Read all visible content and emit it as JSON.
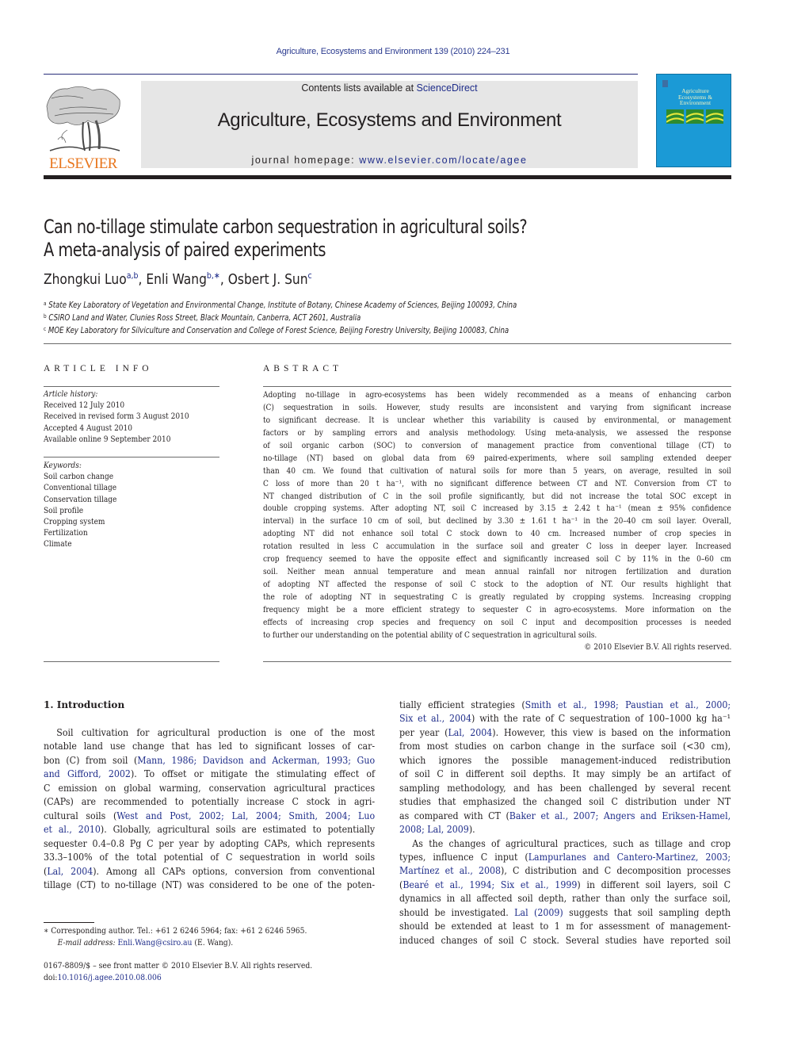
{
  "running_head": "Agriculture, Ecosystems and Environment 139 (2010) 224–231",
  "publisher": {
    "logo_text": "ELSEVIER",
    "logo_color": "#e8761d"
  },
  "banner": {
    "contents_prefix": "Contents lists available at ",
    "contents_link": "ScienceDirect",
    "journal_name": "Agriculture, Ecosystems and Environment",
    "homepage_prefix": "journal homepage: ",
    "homepage_link": "www.elsevier.com/locate/agee",
    "background": "#e6e6e6"
  },
  "cover": {
    "title_lines": [
      "Agriculture",
      "Ecosystems &",
      "Environment"
    ],
    "color": "#1b9ad6"
  },
  "article": {
    "title_line1": "Can no-tillage stimulate carbon sequestration in agricultural soils?",
    "title_line2": "A meta-analysis of paired experiments",
    "authors": [
      {
        "name": "Zhongkui Luo",
        "sup": "a,b"
      },
      {
        "name": "Enli Wang",
        "sup": "b,∗"
      },
      {
        "name": "Osbert J. Sun",
        "sup": "c"
      }
    ],
    "affiliations": [
      {
        "mark": "a",
        "text": "State Key Laboratory of Vegetation and Environmental Change, Institute of Botany, Chinese Academy of Sciences, Beijing 100093, China"
      },
      {
        "mark": "b",
        "text": "CSIRO Land and Water, Clunies Ross Street, Black Mountain, Canberra, ACT 2601, Australia"
      },
      {
        "mark": "c",
        "text": "MOE Key Laboratory for Silviculture and Conservation and College of Forest Science, Beijing Forestry University, Beijing 100083, China"
      }
    ]
  },
  "article_info": {
    "heading": "ARTICLE INFO",
    "history_label": "Article history:",
    "history": [
      "Received 12 July 2010",
      "Received in revised form 3 August 2010",
      "Accepted 4 August 2010",
      "Available online 9 September 2010"
    ],
    "keywords_label": "Keywords:",
    "keywords": [
      "Soil carbon change",
      "Conventional tillage",
      "Conservation tillage",
      "Soil profile",
      "Cropping system",
      "Fertilization",
      "Climate"
    ]
  },
  "abstract": {
    "heading": "ABSTRACT",
    "lines": [
      "Adopting no-tillage in agro-ecosystems has been widely recommended as a means of enhancing carbon",
      "(C) sequestration in soils. However, study results are inconsistent and varying from significant increase",
      "to significant decrease. It is unclear whether this variability is caused by environmental, or management",
      "factors or by sampling errors and analysis methodology. Using meta-analysis, we assessed the response",
      "of soil organic carbon (SOC) to conversion of management practice from conventional tillage (CT) to",
      "no-tillage (NT) based on global data from 69 paired-experiments, where soil sampling extended deeper",
      "than 40 cm. We found that cultivation of natural soils for more than 5 years, on average, resulted in soil",
      "C loss of more than 20 t ha⁻¹, with no significant difference between CT and NT. Conversion from CT to",
      "NT changed distribution of C in the soil profile significantly, but did not increase the total SOC except in",
      "double cropping systems. After adopting NT, soil C increased by 3.15 ± 2.42 t ha⁻¹ (mean ± 95% confidence",
      "interval) in the surface 10 cm of soil, but declined by 3.30 ± 1.61 t ha⁻¹ in the 20–40 cm soil layer. Overall,",
      "adopting NT did not enhance soil total C stock down to 40 cm. Increased number of crop species in",
      "rotation resulted in less C accumulation in the surface soil and greater C loss in deeper layer. Increased",
      "crop frequency seemed to have the opposite effect and significantly increased soil C by 11% in the 0–60 cm",
      "soil. Neither mean annual temperature and mean annual rainfall nor nitrogen fertilization and duration",
      "of adopting NT affected the response of soil C stock to the adoption of NT. Our results highlight that",
      "the role of adopting NT in sequestrating C is greatly regulated by cropping systems. Increasing cropping",
      "frequency might be a more efficient strategy to sequester C in agro-ecosystems. More information on the",
      "effects of increasing crop species and frequency on soil C input and decomposition processes is needed",
      "to further our understanding on the potential ability of C sequestration in agricultural soils."
    ],
    "copyright": "© 2010 Elsevier B.V. All rights reserved."
  },
  "introduction": {
    "heading": "1.  Introduction",
    "left_lines": [
      [
        {
          "t": "Soil cultivation for agricultural production is one of the most"
        }
      ],
      [
        {
          "t": "notable land use change that has led to significant losses of car-"
        }
      ],
      [
        {
          "t": "bon (C) from soil ("
        },
        {
          "t": "Mann, 1986; Davidson and Ackerman, 1993; Guo",
          "link": true
        }
      ],
      [
        {
          "t": "and Gifford, 2002",
          "link": true
        },
        {
          "t": "). To offset or mitigate the stimulating effect of"
        }
      ],
      [
        {
          "t": "C emission on global warming, conservation agricultural practices"
        }
      ],
      [
        {
          "t": "(CAPs) are recommended to potentially increase C stock in agri-"
        }
      ],
      [
        {
          "t": "cultural soils ("
        },
        {
          "t": "West and Post, 2002; Lal, 2004; Smith, 2004; Luo",
          "link": true
        }
      ],
      [
        {
          "t": "et al., 2010",
          "link": true
        },
        {
          "t": "). Globally, agricultural soils are estimated to potentially"
        }
      ],
      [
        {
          "t": "sequester 0.4–0.8 Pg C per year by adopting CAPs, which represents"
        }
      ],
      [
        {
          "t": "33.3–100% of the total potential of C sequestration in world soils"
        }
      ],
      [
        {
          "t": "("
        },
        {
          "t": "Lal, 2004",
          "link": true
        },
        {
          "t": "). Among all CAPs options, conversion from conventional"
        }
      ],
      [
        {
          "t": "tillage (CT) to no-tillage (NT) was considered to be one of the poten-"
        }
      ]
    ],
    "right_lines": [
      [
        {
          "t": "tially efficient strategies ("
        },
        {
          "t": "Smith et al., 1998; Paustian et al., 2000;",
          "link": true
        }
      ],
      [
        {
          "t": "Six et al., 2004",
          "link": true
        },
        {
          "t": ") with the rate of C sequestration of 100–1000 kg ha⁻¹"
        }
      ],
      [
        {
          "t": "per year ("
        },
        {
          "t": "Lal, 2004",
          "link": true
        },
        {
          "t": "). However, this view is based on the information"
        }
      ],
      [
        {
          "t": "from most studies on carbon change in the surface soil (<30 cm),"
        }
      ],
      [
        {
          "t": "which ignores the possible management-induced redistribution"
        }
      ],
      [
        {
          "t": "of soil C in different soil depths. It may simply be an artifact of"
        }
      ],
      [
        {
          "t": "sampling methodology, and has been challenged by several recent"
        }
      ],
      [
        {
          "t": "studies that emphasized the changed soil C distribution under NT"
        }
      ],
      [
        {
          "t": "as compared with CT ("
        },
        {
          "t": "Baker et al., 2007; Angers and Eriksen-Hamel,",
          "link": true
        }
      ],
      [
        {
          "t": "2008; Lal, 2009",
          "link": true
        },
        {
          "t": ")."
        }
      ],
      [
        {
          "t": "As the changes of agricultural practices, such as tillage and crop"
        }
      ],
      [
        {
          "t": "types, influence C input ("
        },
        {
          "t": "Lampurlanes and Cantero-Martinez, 2003;",
          "link": true
        }
      ],
      [
        {
          "t": "Martínez et al., 2008",
          "link": true
        },
        {
          "t": "), C distribution and C decomposition processes"
        }
      ],
      [
        {
          "t": "("
        },
        {
          "t": "Bearé et al., 1994; Six et al., 1999",
          "link": true
        },
        {
          "t": ") in different soil layers, soil C"
        }
      ],
      [
        {
          "t": "dynamics in all affected soil depth, rather than only the surface soil,"
        }
      ],
      [
        {
          "t": "should be investigated. "
        },
        {
          "t": "Lal (2009)",
          "link": true
        },
        {
          "t": " suggests that soil sampling depth"
        }
      ],
      [
        {
          "t": "should be extended at least to 1 m for assessment of management-"
        }
      ],
      [
        {
          "t": "induced changes of soil C stock. Several studies have reported soil"
        }
      ]
    ]
  },
  "footnote": {
    "corresponding": "∗  Corresponding author. Tel.: +61 2 6246 5964; fax: +61 2 6246 5965.",
    "email_label": "E-mail address: ",
    "email": "Enli.Wang@csiro.au",
    "email_suffix": " (E. Wang).",
    "issn": "0167-8809/$ – see front matter © 2010 Elsevier B.V. All rights reserved.",
    "doi_label": "doi:",
    "doi": "10.1016/j.agee.2010.08.006"
  }
}
